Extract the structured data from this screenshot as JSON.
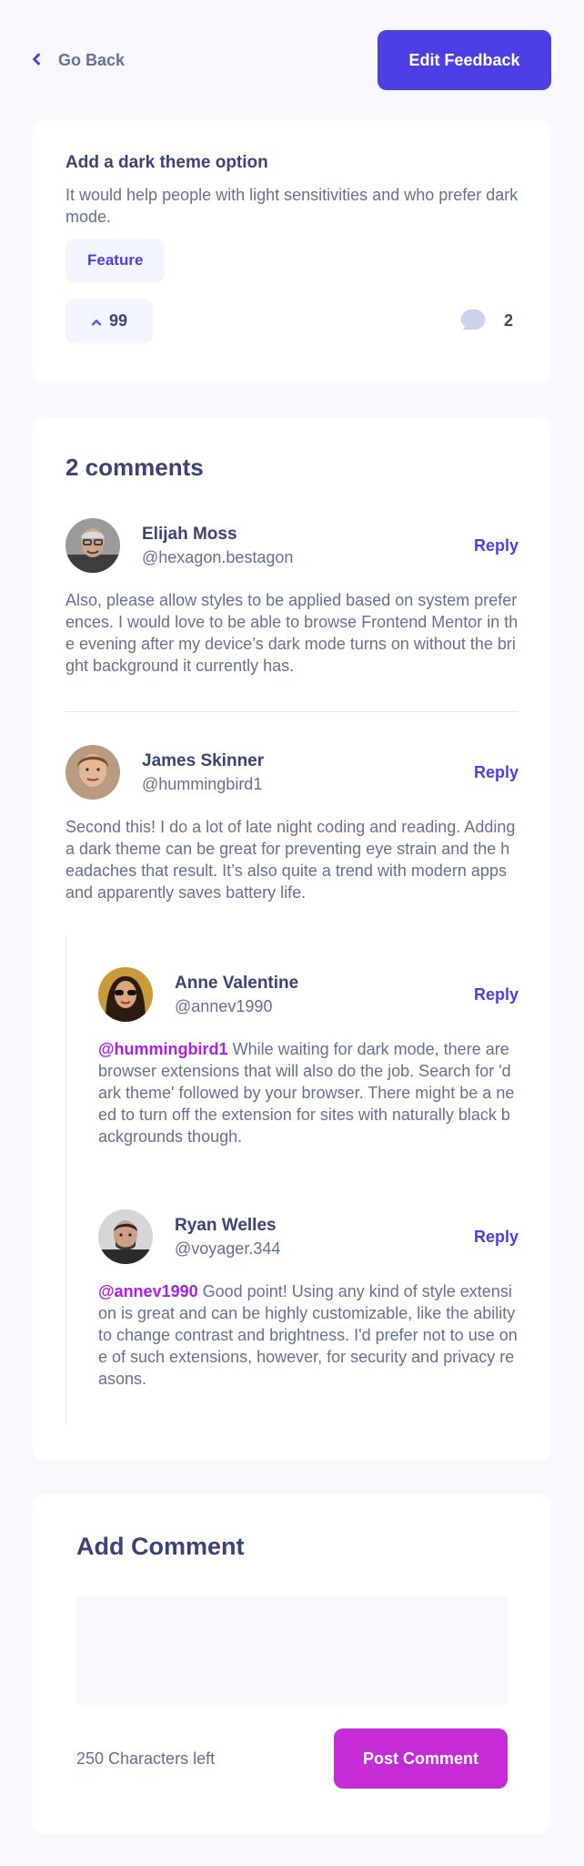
{
  "header": {
    "back_label": "Go Back",
    "edit_label": "Edit Feedback"
  },
  "feedback": {
    "title": "Add a dark theme option",
    "description": "It would help people with light sensitivities and who prefer dark mode.",
    "category": "Feature",
    "upvotes": "99",
    "comment_count": "2"
  },
  "comments_section": {
    "title": "2 comments",
    "reply_label": "Reply",
    "comments": [
      {
        "name": "Elijah Moss",
        "username": "@hexagon.bestagon",
        "body": "Also, please allow styles to be applied based on system preferences. I would love to be able to browse Frontend Mentor in the evening after my device’s dark mode turns on without the bright background it currently has."
      },
      {
        "name": "James Skinner",
        "username": "@hummingbird1",
        "body": "Second this! I do a lot of late night coding and reading. Adding a dark theme can be great for preventing eye strain and the headaches that result. It’s also quite a trend with modern apps and apparently saves battery life.",
        "replies": [
          {
            "name": "Anne Valentine",
            "username": "@annev1990",
            "mention": "@hummingbird1",
            "body": "While waiting for dark mode, there are browser extensions that will also do the job. Search for 'dark theme' followed by your browser. There might be a need to turn off the extension for sites with naturally black backgrounds though."
          },
          {
            "name": "Ryan Welles",
            "username": "@voyager.344",
            "mention": "@annev1990",
            "body": "Good point! Using any kind of style extension is great and can be highly customizable, like the ability to change contrast and brightness. I'd prefer not to use one of such extensions, however, for security and privacy reasons."
          }
        ]
      }
    ]
  },
  "add_comment": {
    "title": "Add Comment",
    "placeholder": "",
    "chars_left": "250 Characters left",
    "post_label": "Post Comment"
  },
  "colors": {
    "primary": "#4C3FE3",
    "accent": "#C42DD6",
    "mention": "#AD1FEA",
    "background": "#F7F8FD"
  }
}
